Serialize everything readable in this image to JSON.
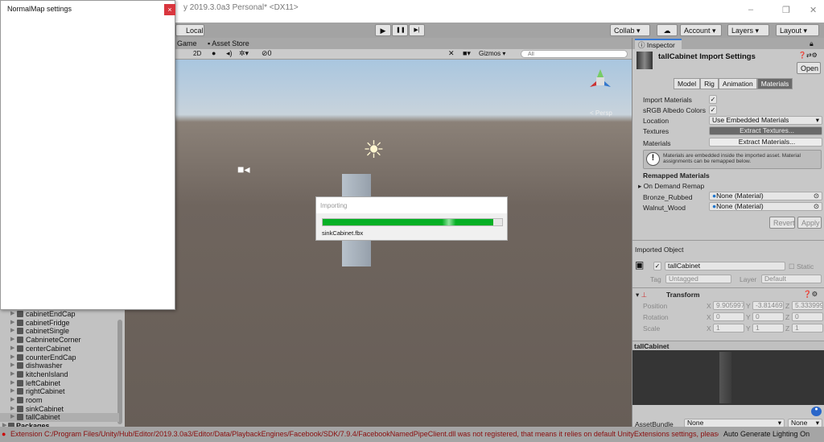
{
  "window": {
    "title": "y 2019.3.0a3 Personal* <DX11>",
    "minimize": "–",
    "maximize": "❐",
    "close": "✕"
  },
  "toolbar": {
    "local": "Local",
    "collab": "Collab",
    "account": "Account",
    "layers": "Layers",
    "layout": "Layout",
    "play": "▶",
    "pause": "❚❚",
    "step": "▶|"
  },
  "tabs": [
    "Game",
    "Asset Store"
  ],
  "scene_toolbar": {
    "mode_2d": "2D",
    "hidden_count": "0",
    "gizmos": "Gizmos",
    "search_placeholder": "All",
    "persp": "< Persp"
  },
  "hierarchy": {
    "items": [
      "cabinetEndCap",
      "cabinetFridge",
      "cabinetSingle",
      "CabnineteCorner",
      "centerCabinet",
      "counterEndCap",
      "dishwasher",
      "kitchenIsland",
      "leftCabinet",
      "rightCabinet",
      "room",
      "sinkCabinet",
      "tallCabinet"
    ],
    "packages": "Packages"
  },
  "dialog": {
    "title": "NormalMap settings",
    "close": "×"
  },
  "importing": {
    "title": "Importing",
    "file": "sinkCabinet.fbx",
    "progress": 0.95
  },
  "inspector": {
    "tab": "Inspector",
    "header": "tallCabinet Import Settings",
    "open": "Open",
    "subtabs": [
      "Model",
      "Rig",
      "Animation",
      "Materials"
    ],
    "import_materials": "Import Materials",
    "srgb": "sRGB Albedo Colors",
    "location_label": "Location",
    "location_value": "Use Embedded Materials",
    "textures_label": "Textures",
    "extract_textures": "Extract Textures...",
    "materials_label": "Materials",
    "extract_materials": "Extract Materials...",
    "info": "Materials are embedded inside the imported asset. Material assignments can be remapped below.",
    "remapped": "Remapped Materials",
    "on_demand": "On Demand Remap",
    "remaps": [
      {
        "name": "Bronze_Rubbed",
        "value": "None (Material)"
      },
      {
        "name": "Walnut_Wood",
        "value": "None (Material)"
      }
    ],
    "revert": "Revert",
    "apply": "Apply",
    "imported_object": "Imported Object",
    "object_name": "tallCabinet",
    "static": "Static",
    "tag_label": "Tag",
    "tag": "Untagged",
    "layer_label": "Layer",
    "layer": "Default",
    "transform": "Transform",
    "position": {
      "label": "Position",
      "x": "9.905997",
      "y": "-3.81469",
      "z": "5.333999"
    },
    "rotation": {
      "label": "Rotation",
      "x": "0",
      "y": "0",
      "z": "0"
    },
    "scale": {
      "label": "Scale",
      "x": "1",
      "y": "1",
      "z": "1"
    },
    "preview_title": "tallCabinet",
    "assetbundle_label": "AssetBundle",
    "assetbundle": "None",
    "variant": "None"
  },
  "status": {
    "message": "Extension C:/Program Files/Unity/Hub/Editor/2019.3.0a3/Editor/Data/PlaybackEngines/Facebook/SDK/7.9.4/FacebookNamedPipeClient.dll was not registered, that means it relies on default UnityExtensions settings, please",
    "lighting": "Auto Generate Lighting On"
  }
}
